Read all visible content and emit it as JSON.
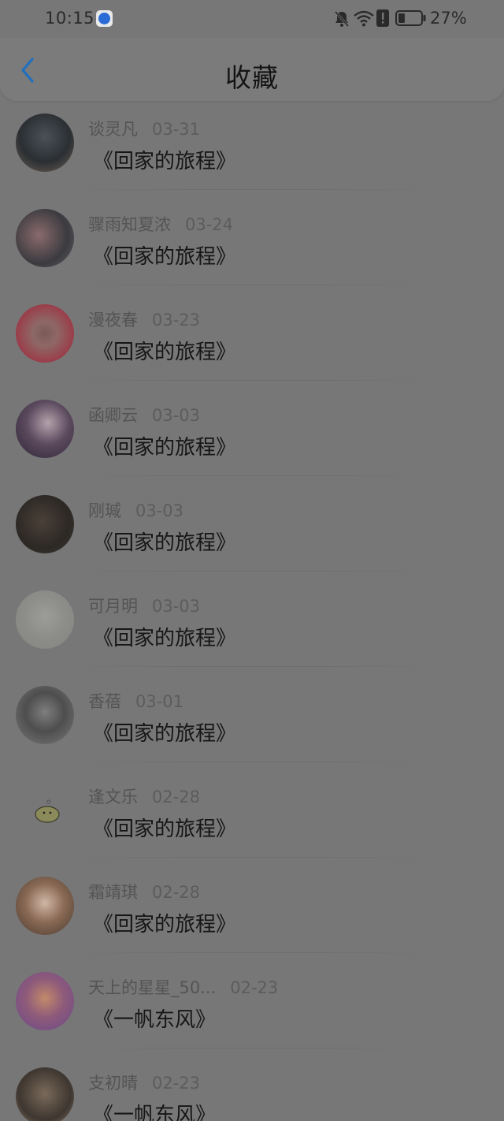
{
  "status_bar": {
    "time": "10:15",
    "battery": "27%",
    "icons": [
      "app-icon",
      "bell-off-icon",
      "wifi-icon",
      "alert-icon",
      "battery-icon"
    ]
  },
  "header": {
    "title": "收藏",
    "back_icon": "chevron-left-icon",
    "accent_color": "#1f6fbf"
  },
  "items": [
    {
      "name": "谈灵凡",
      "date": "03-31",
      "title": "《回家的旅程》"
    },
    {
      "name": "骤雨知夏浓",
      "date": "03-24",
      "title": "《回家的旅程》"
    },
    {
      "name": "漫夜春",
      "date": "03-23",
      "title": "《回家的旅程》"
    },
    {
      "name": "函卿云",
      "date": "03-03",
      "title": "《回家的旅程》"
    },
    {
      "name": "刚瑊",
      "date": "03-03",
      "title": "《回家的旅程》"
    },
    {
      "name": "可月明",
      "date": "03-03",
      "title": "《回家的旅程》"
    },
    {
      "name": "香蓓",
      "date": "03-01",
      "title": "《回家的旅程》"
    },
    {
      "name": "逢文乐",
      "date": "02-28",
      "title": "《回家的旅程》"
    },
    {
      "name": "霜靖琪",
      "date": "02-28",
      "title": "《回家的旅程》"
    },
    {
      "name": "天上的星星_50...",
      "date": "02-23",
      "title": "《一帆东风》"
    },
    {
      "name": "支初晴",
      "date": "02-23",
      "title": "《一帆东风》"
    }
  ]
}
